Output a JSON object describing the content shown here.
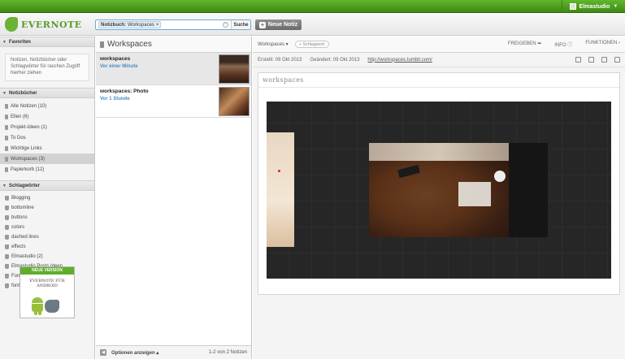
{
  "topbar": {
    "user": "Elmastudio"
  },
  "header": {
    "logo": "EVERNOTE",
    "search_chip_label": "Notizbuch:",
    "search_chip_value": "Workspaces",
    "search_chip_close": "×",
    "search_clear": "×",
    "search_button": "Suche",
    "new_note": "Neue Notiz"
  },
  "sidebar": {
    "favorites_title": "Favoriten",
    "favorites_hint": "Notizen, Notizbücher oder Schlagwörter für raschen Zugriff hierher ziehen",
    "notebooks_title": "Notizbücher",
    "notebooks": [
      {
        "label": "Alle Notizen (10)"
      },
      {
        "label": "Ellen (6)"
      },
      {
        "label": "Projekt-Ideen (1)"
      },
      {
        "label": "To Dos"
      },
      {
        "label": "Wichtige Links"
      },
      {
        "label": "Workspaces (3)"
      },
      {
        "label": "Papierkorb (12)"
      }
    ],
    "tags_title": "Schlagwörter",
    "tags": [
      {
        "label": "Blogging"
      },
      {
        "label": "bottomline"
      },
      {
        "label": "buttons"
      },
      {
        "label": "colors"
      },
      {
        "label": "dashed lines"
      },
      {
        "label": "effects"
      },
      {
        "label": "Elmastudio (2)"
      },
      {
        "label": "Elmastudio Posts Ideen"
      },
      {
        "label": "Fonts"
      },
      {
        "label": "fonts"
      }
    ],
    "promo_band": "NEUE VERSION",
    "promo_line1": "EVERNOTE FÜR",
    "promo_line2": "ANDROID"
  },
  "notelist": {
    "title": "Workspaces",
    "items": [
      {
        "title": "workspaces",
        "date": "Vor einer Minute"
      },
      {
        "title": "workspaces: Photo",
        "date": "Vor 1 Stunde"
      }
    ],
    "footer_options": "Optionen anzeigen ▴",
    "footer_count": "1-2 von 2 Notizen"
  },
  "editor": {
    "notebook": "Workspaces ▾",
    "tag_button": "+ Schlagwort",
    "share": "FREIGEBEN",
    "info": "INFO",
    "functions": "FUNKTIONEN",
    "created": "Erstellt: 09 Okt 2013",
    "changed": "Geändert: 09 Okt 2013",
    "url": "http://workspaces.tumblr.com/",
    "note_title": "workspaces"
  },
  "colors": {
    "brand_green": "#5fae2b",
    "link_blue": "#4a8cc2"
  }
}
